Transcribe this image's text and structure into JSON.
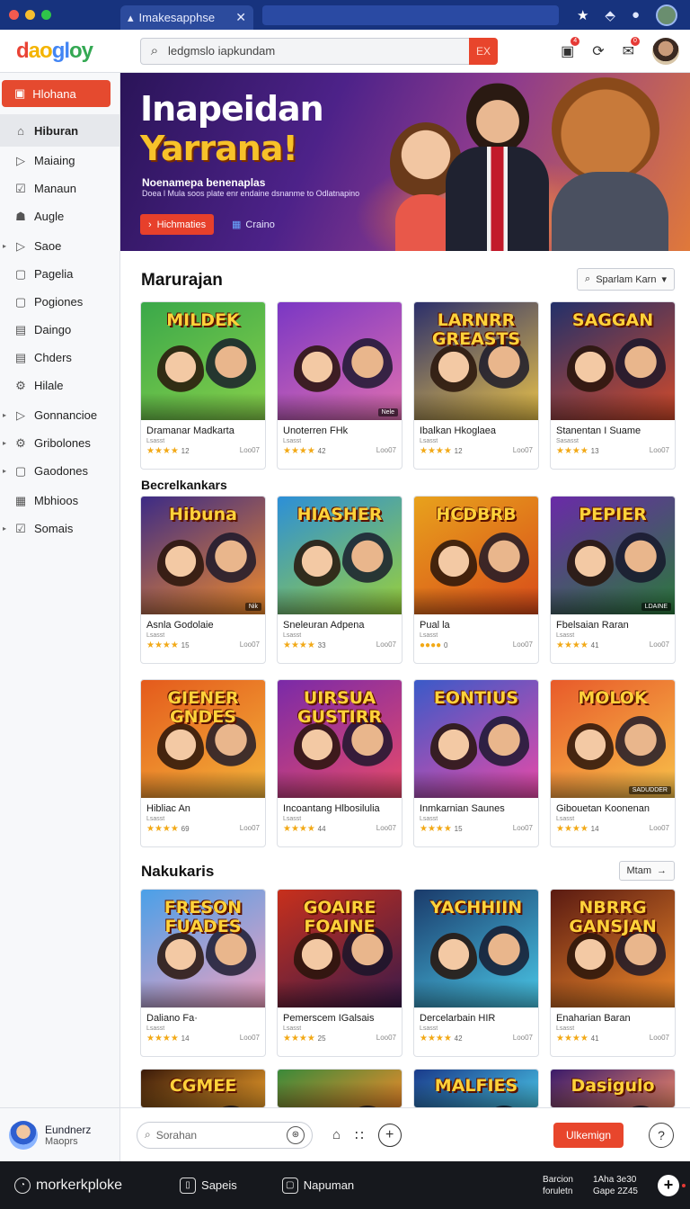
{
  "browser": {
    "tab_title": "Imakesapphse",
    "tab_close": "✕"
  },
  "header": {
    "logo": [
      "d",
      "ao",
      "gl",
      "oy"
    ],
    "search_value": "ledgmslo iapkundam",
    "search_go": "EX",
    "notif_count": "4",
    "msg_count": "0"
  },
  "sidebar": {
    "active": "Hlohana",
    "items": [
      {
        "label": "Hiburan",
        "icon": "home-icon",
        "glyph": "⌂",
        "arrow": ""
      },
      {
        "label": "Maiaing",
        "icon": "play-icon",
        "glyph": "▷",
        "arrow": ""
      },
      {
        "label": "Manaun",
        "icon": "checkbox-icon",
        "glyph": "☑",
        "arrow": ""
      },
      {
        "label": "Augle",
        "icon": "people-icon",
        "glyph": "☗",
        "arrow": ""
      },
      {
        "label": "Saoe",
        "icon": "play-icon",
        "glyph": "▷",
        "arrow": "▸"
      },
      {
        "label": "Pagelia",
        "icon": "page-icon",
        "glyph": "▢",
        "arrow": ""
      },
      {
        "label": "Pogiones",
        "icon": "page-icon",
        "glyph": "▢",
        "arrow": ""
      },
      {
        "label": "Daingo",
        "icon": "page-icon",
        "glyph": "▤",
        "arrow": ""
      },
      {
        "label": "Chders",
        "icon": "list-icon",
        "glyph": "▤",
        "arrow": ""
      },
      {
        "label": "Hilale",
        "icon": "gear-icon",
        "glyph": "⚙",
        "arrow": ""
      },
      {
        "label": "Gonnancioe",
        "icon": "play-icon",
        "glyph": "▷",
        "arrow": "▸"
      },
      {
        "label": "Gribolones",
        "icon": "gear-icon",
        "glyph": "⚙",
        "arrow": "▸"
      },
      {
        "label": "Gaodones",
        "icon": "page-icon",
        "glyph": "▢",
        "arrow": "▸"
      },
      {
        "label": "Mbhioos",
        "icon": "grid-icon",
        "glyph": "▦",
        "arrow": ""
      },
      {
        "label": "Somais",
        "icon": "checkbox-icon",
        "glyph": "☑",
        "arrow": "▸"
      }
    ],
    "user_name": "Eundnerz",
    "user_sub": "Maoprs"
  },
  "hero": {
    "title_line1": "Inapeidan",
    "title_line2": "Yarrana!",
    "subtitle": "Noenamepa benenaplas",
    "description": "Doea l Mula soos plate enr endaine dsnanme to Odlatnapino",
    "cta": "Hichmaties",
    "cta2": "Craino"
  },
  "sections": {
    "s1_title": "Marurajan",
    "s1_dropdown": "Sparlam Karn",
    "s2_title": "Becrelkankars",
    "s3_title": "Nakukaris",
    "s3_dropdown": "Mtam"
  },
  "cards_row1": [
    {
      "name": "Dramanar Madkarta",
      "meta": "Lsasst",
      "rating": "★★★★",
      "num": "12",
      "label": "Loo07",
      "thumb": "MILDEK",
      "tag": "",
      "bg": "#3aa84a",
      "bg2": "#87d04a"
    },
    {
      "name": "Unoterren FHk",
      "meta": "Lsasst",
      "rating": "★★★★",
      "num": "42",
      "label": "Loo07",
      "thumb": "",
      "tag": "Nele",
      "bg": "#7a37c4",
      "bg2": "#e06fb0"
    },
    {
      "name": "Ibalkan Hkoglaea",
      "meta": "Lsasst",
      "rating": "★★★★",
      "num": "12",
      "label": "Loo07",
      "thumb": "LARNRR GREASTS",
      "tag": "",
      "bg": "#2b2f6b",
      "bg2": "#e8c14a"
    },
    {
      "name": "Stanentan I Suame",
      "meta": "Sasasst",
      "rating": "★★★★",
      "num": "13",
      "label": "Loo07",
      "thumb": "SAGGAN",
      "tag": "",
      "bg": "#22306a",
      "bg2": "#d24a2a"
    }
  ],
  "cards_row2": [
    {
      "name": "Asnla Godolaie",
      "meta": "Lsasst",
      "rating": "★★★★",
      "num": "15",
      "label": "Loo07",
      "thumb": "Hibuna",
      "tag": "Nik",
      "bg": "#3c2b86",
      "bg2": "#f08a2a"
    },
    {
      "name": "Sneleuran Adpena",
      "meta": "Lsasst",
      "rating": "★★★★",
      "num": "33",
      "label": "Loo07",
      "thumb": "HIASHER",
      "tag": "",
      "bg": "#2c8fd8",
      "bg2": "#9ad03a"
    },
    {
      "name": "Pual la",
      "meta": "Lsasst",
      "rating": "●●●●",
      "num": "0",
      "label": "Loo07",
      "thumb": "HCDBRB",
      "tag": "",
      "bg": "#e8a21c",
      "bg2": "#d84a1a"
    },
    {
      "name": "Fbelsaian Raran",
      "meta": "Lsasst",
      "rating": "★★★★",
      "num": "41",
      "label": "Loo07",
      "thumb": "PEPIER",
      "tag": "LDAINE",
      "bg": "#6a2aa8",
      "bg2": "#2a7a3a"
    }
  ],
  "cards_row3": [
    {
      "name": "Hibliac An",
      "meta": "Lsasst",
      "rating": "★★★★",
      "num": "69",
      "label": "Loo07",
      "thumb": "GIENER GNDES",
      "tag": "",
      "bg": "#e45a1c",
      "bg2": "#f4b43a"
    },
    {
      "name": "Incoantang Hlbosilulia",
      "meta": "Lsasst",
      "rating": "★★★★",
      "num": "44",
      "label": "Loo07",
      "thumb": "UIRSUA GUSTIRR",
      "tag": "",
      "bg": "#7a2aa8",
      "bg2": "#e84a6a"
    },
    {
      "name": "Inmkarnian Saunes",
      "meta": "Lsasst",
      "rating": "★★★★",
      "num": "15",
      "label": "Loo07",
      "thumb": "EONTIUS",
      "tag": "",
      "bg": "#3a5ac8",
      "bg2": "#e84aa8"
    },
    {
      "name": "Gibouetan Koonenan",
      "meta": "Lsasst",
      "rating": "★★★★",
      "num": "14",
      "label": "Loo07",
      "thumb": "MOLOK",
      "tag": "SADUDDER",
      "bg": "#e85a2a",
      "bg2": "#f8c24a"
    }
  ],
  "cards_row4": [
    {
      "name": "Daliano Fa·",
      "meta": "Lsasst",
      "rating": "★★★★",
      "num": "14",
      "label": "Loo07",
      "thumb": "FRESON FUADES",
      "tag": "",
      "bg": "#4aa0e8",
      "bg2": "#f0a0c0"
    },
    {
      "name": "Pemerscem IGalsais",
      "meta": "Lsasst",
      "rating": "★★★★",
      "num": "25",
      "label": "Loo07",
      "thumb": "GOAIRE FOAINE",
      "tag": "",
      "bg": "#c8301c",
      "bg2": "#3a1a4a"
    },
    {
      "name": "Dercelarbain HIR",
      "meta": "Lsasst",
      "rating": "★★★★",
      "num": "42",
      "label": "Loo07",
      "thumb": "YACHHIIN",
      "tag": "",
      "bg": "#1a3a6a",
      "bg2": "#4ac8e8"
    },
    {
      "name": "Enaharian Baran",
      "meta": "Lsasst",
      "rating": "★★★★",
      "num": "41",
      "label": "Loo07",
      "thumb": "NBRRG GANSJAN",
      "tag": "",
      "bg": "#5a1a12",
      "bg2": "#f08a2a"
    }
  ],
  "cards_row5": [
    {
      "thumb": "CGMEE",
      "bg": "#3a1a0a",
      "bg2": "#f0a02a"
    },
    {
      "thumb": "",
      "bg": "#3a8a3a",
      "bg2": "#f08a2a"
    },
    {
      "thumb": "MALFIES",
      "bg": "#1a3a8a",
      "bg2": "#4ac8e8"
    },
    {
      "thumb": "Dasigulo",
      "bg": "#3a1a6a",
      "bg2": "#f08a6a"
    }
  ],
  "bottombar": {
    "search_placeholder": "Sorahan",
    "cta": "Ulkemign"
  },
  "taskbar": {
    "app": "morkerkploke",
    "item1": "Sapeis",
    "item2": "Napuman",
    "tray1_a": "Barcion",
    "tray1_b": "foruletn",
    "tray2_a": "1Aha 3e30",
    "tray2_b": "Gape 2Z45"
  },
  "colors": {
    "accent": "#e8452c",
    "titlebar": "#17337e"
  }
}
